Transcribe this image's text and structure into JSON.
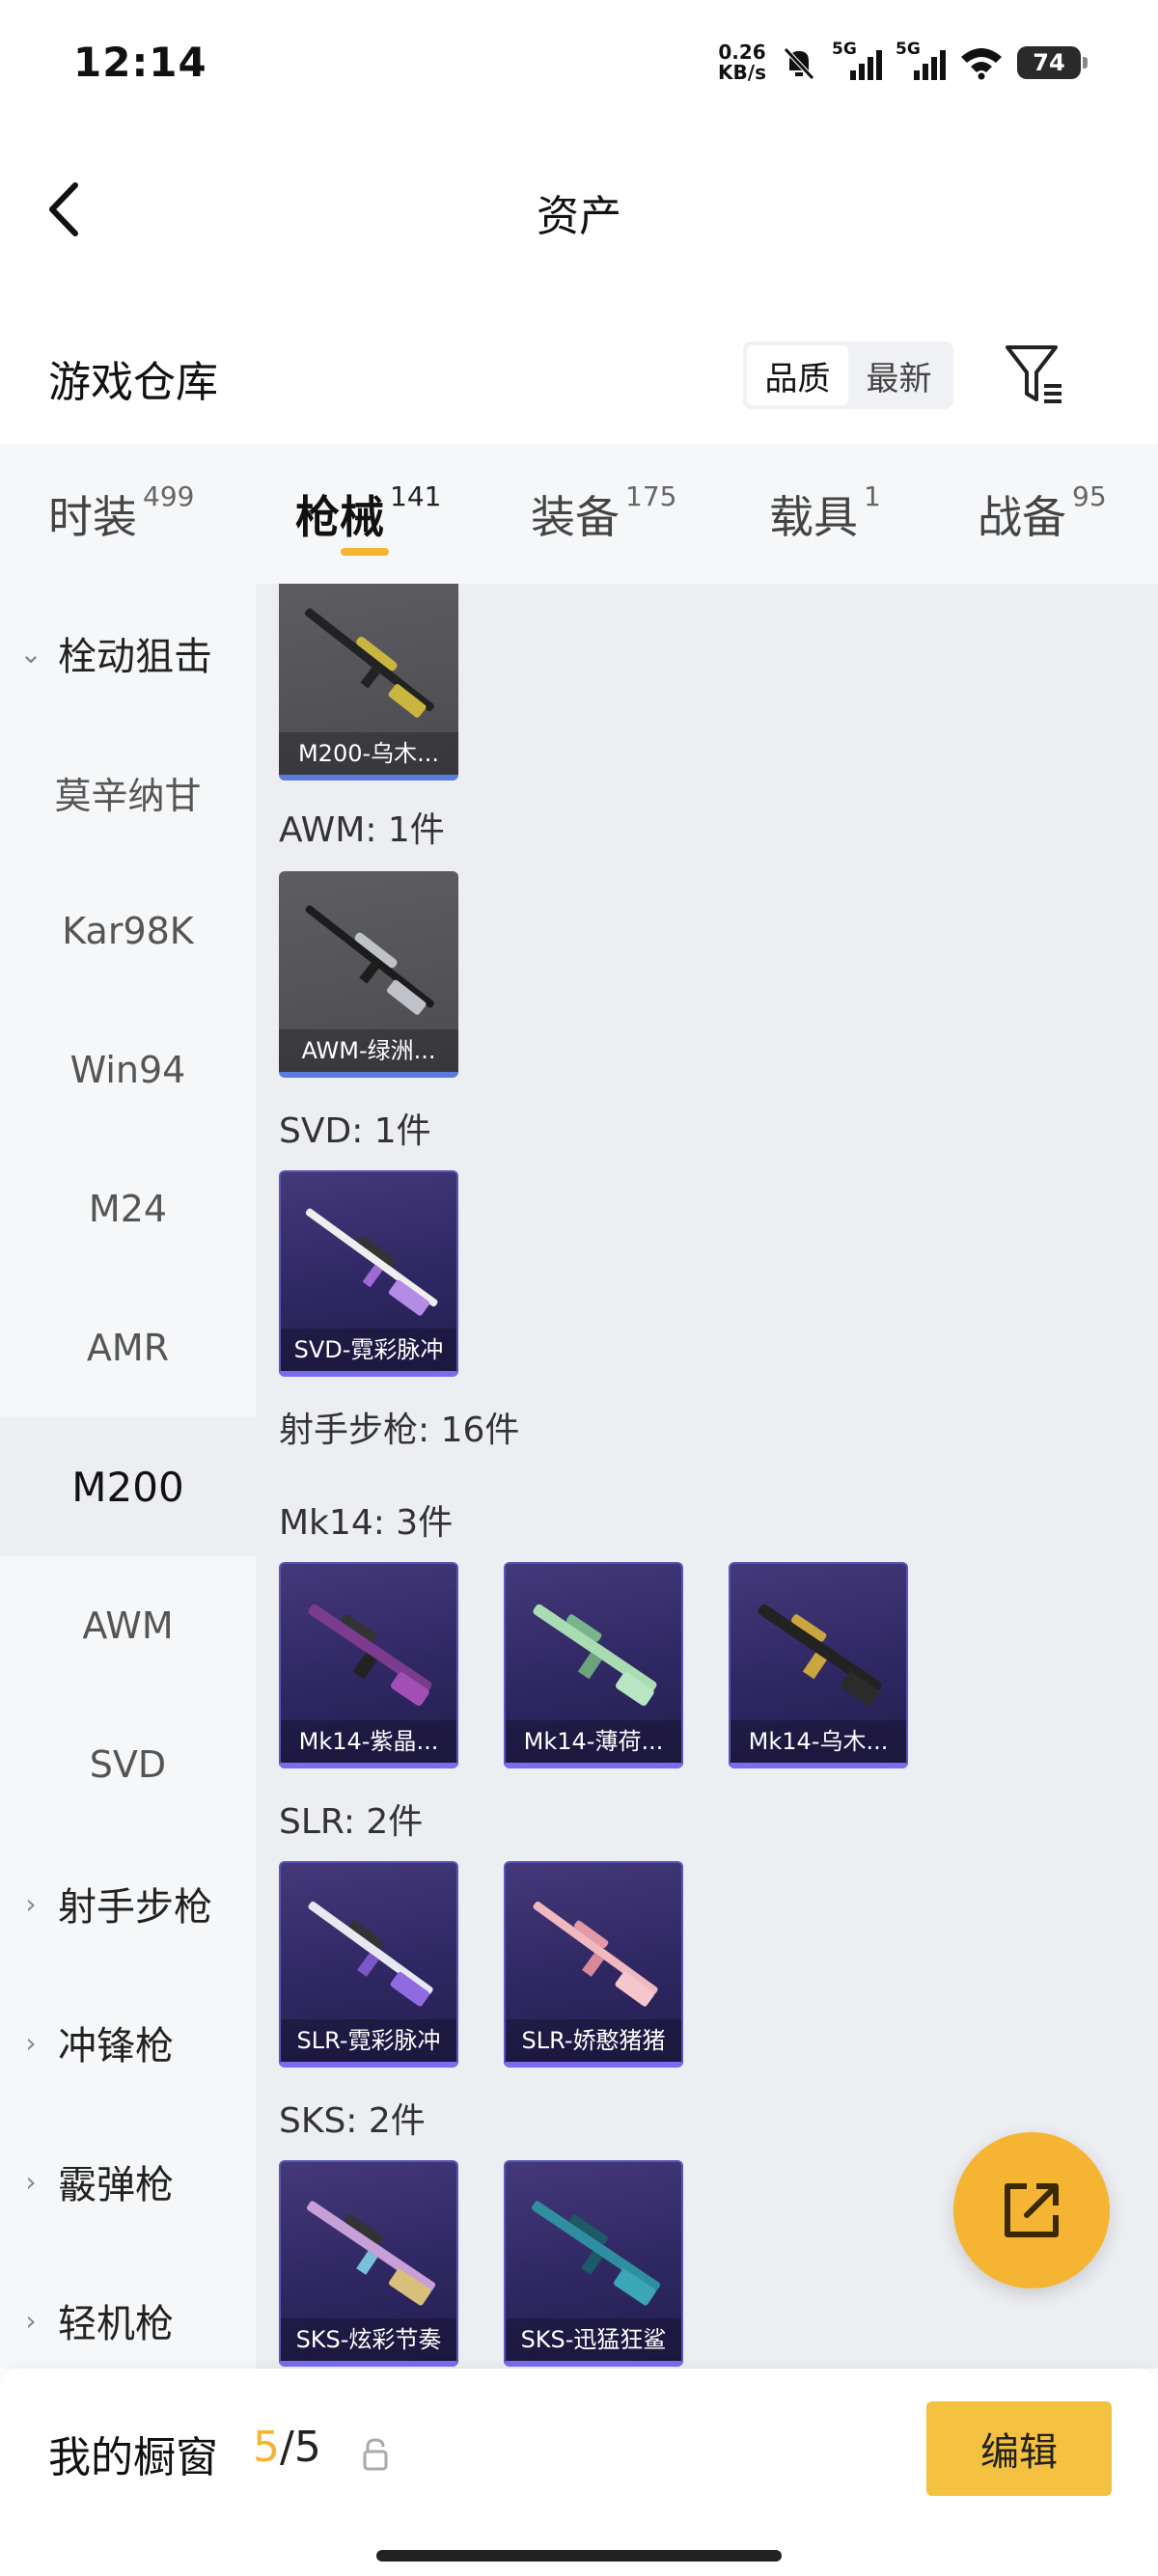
{
  "status": {
    "time": "12:14",
    "speed_value": "0.26",
    "speed_unit": "KB/s",
    "sim1": "5G",
    "sim2": "5G",
    "battery": "74"
  },
  "nav": {
    "title": "资产"
  },
  "section": {
    "title": "游戏仓库",
    "sort_quality": "品质",
    "sort_latest": "最新"
  },
  "tabs": [
    {
      "label": "时装",
      "count": "499"
    },
    {
      "label": "枪械",
      "count": "141"
    },
    {
      "label": "装备",
      "count": "175"
    },
    {
      "label": "载具",
      "count": "1"
    },
    {
      "label": "战备",
      "count": "95"
    }
  ],
  "sidebar": [
    {
      "label": "栓动狙击",
      "type": "group-expanded"
    },
    {
      "label": "莫辛纳甘"
    },
    {
      "label": "Kar98K"
    },
    {
      "label": "Win94"
    },
    {
      "label": "M24"
    },
    {
      "label": "AMR"
    },
    {
      "label": "M200",
      "active": true
    },
    {
      "label": "AWM"
    },
    {
      "label": "SVD"
    },
    {
      "label": "射手步枪",
      "type": "group-collapsed"
    },
    {
      "label": "冲锋枪",
      "type": "group-collapsed"
    },
    {
      "label": "霰弹枪",
      "type": "group-collapsed"
    },
    {
      "label": "轻机枪",
      "type": "group-collapsed"
    }
  ],
  "content": {
    "labels": {
      "awm": "AWM: 1件",
      "svd": "SVD: 1件",
      "marksman": "射手步枪: 16件",
      "mk14": "Mk14: 3件",
      "slr": "SLR: 2件",
      "sks": "SKS: 2件"
    },
    "items": {
      "m200": "M200-乌木...",
      "awm": "AWM-绿洲...",
      "svd": "SVD-霓彩脉冲",
      "mk14_1": "Mk14-紫晶...",
      "mk14_2": "Mk14-薄荷...",
      "mk14_3": "Mk14-乌木...",
      "slr_1": "SLR-霓彩脉冲",
      "slr_2": "SLR-娇憨猪猪",
      "sks_1": "SKS-炫彩节奏",
      "sks_2": "SKS-迅猛狂鲨"
    }
  },
  "bottom": {
    "label": "我的橱窗",
    "current": "5",
    "sep_total": "/5",
    "edit": "编辑"
  },
  "colors": {
    "accent": "#f5b533",
    "card_rare": "#2d2660",
    "card_common": "#55555a"
  }
}
